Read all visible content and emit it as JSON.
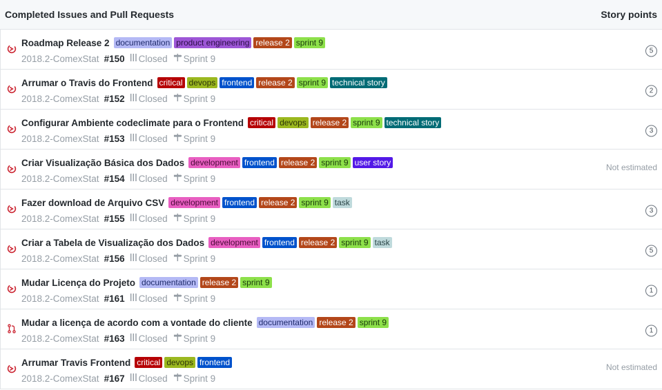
{
  "header": {
    "title": "Completed Issues and Pull Requests",
    "points_label": "Story points"
  },
  "colors": {
    "documentation": {
      "bg": "#b4b9f5",
      "fg": "#1f2b6b"
    },
    "product engineering": {
      "bg": "#9d56d6",
      "fg": "#2a0d45"
    },
    "release 2": {
      "bg": "#b3471a",
      "fg": "#ffffff"
    },
    "sprint 9": {
      "bg": "#8de04a",
      "fg": "#18390a"
    },
    "critical": {
      "bg": "#b60205",
      "fg": "#ffffff"
    },
    "devops": {
      "bg": "#9bb81f",
      "fg": "#2c3308"
    },
    "frontend": {
      "bg": "#0052cc",
      "fg": "#ffffff"
    },
    "technical story": {
      "bg": "#006b75",
      "fg": "#ffffff"
    },
    "development": {
      "bg": "#e85ec1",
      "fg": "#4a0b37"
    },
    "user story": {
      "bg": "#5319e7",
      "fg": "#ffffff"
    },
    "task": {
      "bg": "#bfdadc",
      "fg": "#2b4547"
    }
  },
  "items": [
    {
      "type": "issue",
      "title": "Roadmap Release 2",
      "labels": [
        "documentation",
        "product engineering",
        "release 2",
        "sprint 9"
      ],
      "repo": "2018.2-ComexStat",
      "number": "#150",
      "state": "Closed",
      "milestone": "Sprint 9",
      "points": "5",
      "not_estimated": ""
    },
    {
      "type": "issue",
      "title": "Arrumar o Travis do Frontend",
      "labels": [
        "critical",
        "devops",
        "frontend",
        "release 2",
        "sprint 9",
        "technical story"
      ],
      "repo": "2018.2-ComexStat",
      "number": "#152",
      "state": "Closed",
      "milestone": "Sprint 9",
      "points": "2",
      "not_estimated": ""
    },
    {
      "type": "issue",
      "title": "Configurar Ambiente codeclimate para o Frontend",
      "labels": [
        "critical",
        "devops",
        "release 2",
        "sprint 9",
        "technical story"
      ],
      "repo": "2018.2-ComexStat",
      "number": "#153",
      "state": "Closed",
      "milestone": "Sprint 9",
      "points": "3",
      "not_estimated": ""
    },
    {
      "type": "issue",
      "title": "Criar Visualização Básica dos Dados",
      "labels": [
        "development",
        "frontend",
        "release 2",
        "sprint 9",
        "user story"
      ],
      "repo": "2018.2-ComexStat",
      "number": "#154",
      "state": "Closed",
      "milestone": "Sprint 9",
      "points": "",
      "not_estimated": "Not estimated"
    },
    {
      "type": "issue",
      "title": "Fazer download de Arquivo CSV",
      "labels": [
        "development",
        "frontend",
        "release 2",
        "sprint 9",
        "task"
      ],
      "repo": "2018.2-ComexStat",
      "number": "#155",
      "state": "Closed",
      "milestone": "Sprint 9",
      "points": "3",
      "not_estimated": ""
    },
    {
      "type": "issue",
      "title": "Criar a Tabela de Visualização dos Dados",
      "labels": [
        "development",
        "frontend",
        "release 2",
        "sprint 9",
        "task"
      ],
      "repo": "2018.2-ComexStat",
      "number": "#156",
      "state": "Closed",
      "milestone": "Sprint 9",
      "points": "5",
      "not_estimated": ""
    },
    {
      "type": "issue",
      "title": "Mudar Licença do Projeto",
      "labels": [
        "documentation",
        "release 2",
        "sprint 9"
      ],
      "repo": "2018.2-ComexStat",
      "number": "#161",
      "state": "Closed",
      "milestone": "Sprint 9",
      "points": "1",
      "not_estimated": ""
    },
    {
      "type": "pr",
      "title": "Mudar a licença de acordo com a vontade do cliente",
      "labels": [
        "documentation",
        "release 2",
        "sprint 9"
      ],
      "repo": "2018.2-ComexStat",
      "number": "#163",
      "state": "Closed",
      "milestone": "Sprint 9",
      "points": "1",
      "not_estimated": ""
    },
    {
      "type": "issue",
      "title": "Arrumar Travis Frontend",
      "labels": [
        "critical",
        "devops",
        "frontend"
      ],
      "repo": "2018.2-ComexStat",
      "number": "#167",
      "state": "Closed",
      "milestone": "Sprint 9",
      "points": "",
      "not_estimated": "Not estimated"
    }
  ]
}
